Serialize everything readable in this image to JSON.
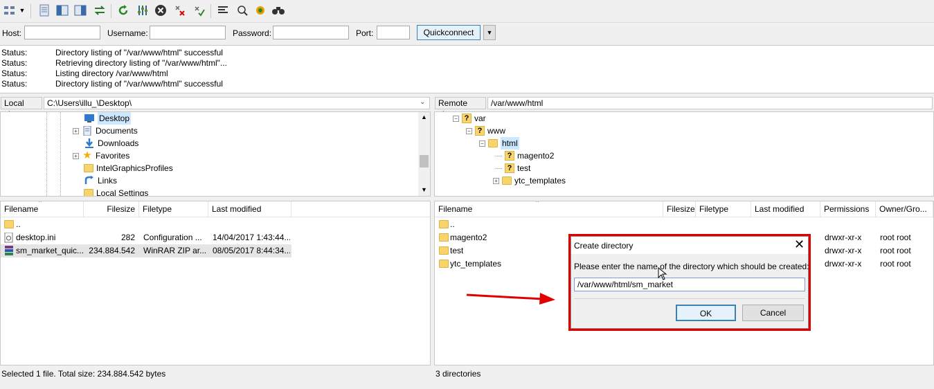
{
  "toolbar": {
    "icons": [
      "site-manager-icon",
      "dropdown-arrow-icon",
      "message-log-icon",
      "local-tree-icon",
      "remote-tree-icon",
      "transfer-queue-icon",
      "refresh-icon",
      "filter-icon",
      "cancel-icon",
      "disconnect-icon",
      "reconnect-icon",
      "directory-comparison-icon",
      "synchronized-browsing-icon",
      "search-icon",
      "binoculars-icon"
    ]
  },
  "quickconnect": {
    "host_label": "Host:",
    "username_label": "Username:",
    "password_label": "Password:",
    "port_label": "Port:",
    "host_value": "",
    "username_value": "",
    "password_value": "",
    "port_value": "",
    "button_label": "Quickconnect"
  },
  "log": [
    {
      "k": "Status:",
      "v": "Directory listing of \"/var/www/html\" successful"
    },
    {
      "k": "Status:",
      "v": "Retrieving directory listing of \"/var/www/html\"..."
    },
    {
      "k": "Status:",
      "v": "Listing directory /var/www/html"
    },
    {
      "k": "Status:",
      "v": "Directory listing of \"/var/www/html\" successful"
    }
  ],
  "local": {
    "site_label": "Local site:",
    "site_path": "C:\\Users\\illu_\\Desktop\\",
    "tree": [
      "Desktop",
      "Documents",
      "Downloads",
      "Favorites",
      "IntelGraphicsProfiles",
      "Links",
      "Local Settings"
    ],
    "columns": [
      "Filename",
      "Filesize",
      "Filetype",
      "Last modified"
    ],
    "files": [
      {
        "name": "..",
        "size": "",
        "type": "",
        "modified": ""
      },
      {
        "name": "desktop.ini",
        "size": "282",
        "type": "Configuration ...",
        "modified": "14/04/2017 1:43:44..."
      },
      {
        "name": "sm_market_quic...",
        "size": "234.884.542",
        "type": "WinRAR ZIP ar...",
        "modified": "08/05/2017 8:44:34..."
      }
    ],
    "status": "Selected 1 file. Total size: 234.884.542 bytes"
  },
  "remote": {
    "site_label": "Remote site:",
    "site_path": "/var/www/html",
    "tree": [
      "var",
      "www",
      "html",
      "magento2",
      "test",
      "ytc_templates"
    ],
    "columns": [
      "Filename",
      "Filesize",
      "Filetype",
      "Last modified",
      "Permissions",
      "Owner/Gro..."
    ],
    "files": [
      {
        "name": "..",
        "perm": "",
        "owner": ""
      },
      {
        "name": "magento2",
        "perm": "drwxr-xr-x",
        "owner": "root root"
      },
      {
        "name": "test",
        "perm": "drwxr-xr-x",
        "owner": "root root"
      },
      {
        "name": "ytc_templates",
        "perm": "drwxr-xr-x",
        "owner": "root root"
      }
    ],
    "status": "3 directories"
  },
  "dialog": {
    "title": "Create directory",
    "prompt": "Please enter the name of the directory which should be created:",
    "value": "/var/www/html/sm_market",
    "ok_label": "OK",
    "cancel_label": "Cancel"
  },
  "colors": {
    "highlight": "#e00000",
    "selection": "#cce8ff",
    "accent": "#3c7fb1"
  }
}
